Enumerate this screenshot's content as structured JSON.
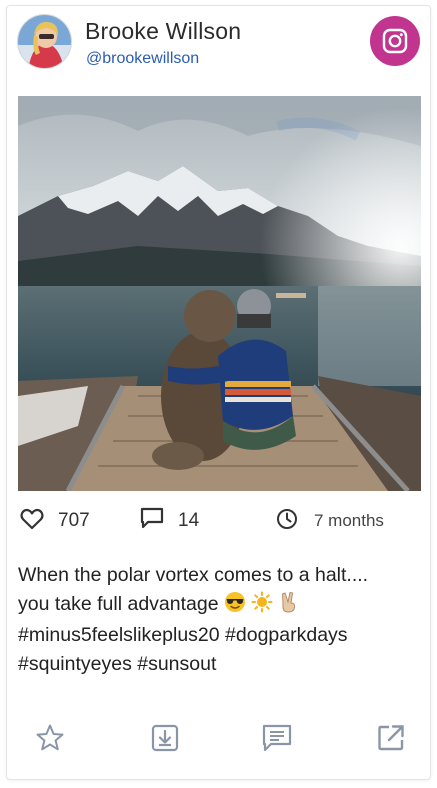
{
  "profile": {
    "name": "Brooke Willson",
    "handle": "@brookewillson",
    "avatar_icon": "avatar-photo",
    "network_icon": "instagram-icon"
  },
  "stats": {
    "likes": "707",
    "comments": "14",
    "posted": "7 months"
  },
  "caption": {
    "line1": "When the polar vortex comes to a halt....",
    "line2": "you take full advantage",
    "emojis": [
      "sunglasses-face-emoji",
      "sun-emoji",
      "victory-hand-emoji"
    ],
    "line3": "#minus5feelslikeplus20 #dogparkdays",
    "line4": "#squintyeyes #sunsout"
  },
  "actions": [
    "star-icon",
    "download-icon",
    "comment-icon",
    "open-external-icon"
  ],
  "colors": {
    "brand_accent": "#c2358f",
    "handle_link": "#2a5db0",
    "icon_gray": "#8a96a8"
  }
}
